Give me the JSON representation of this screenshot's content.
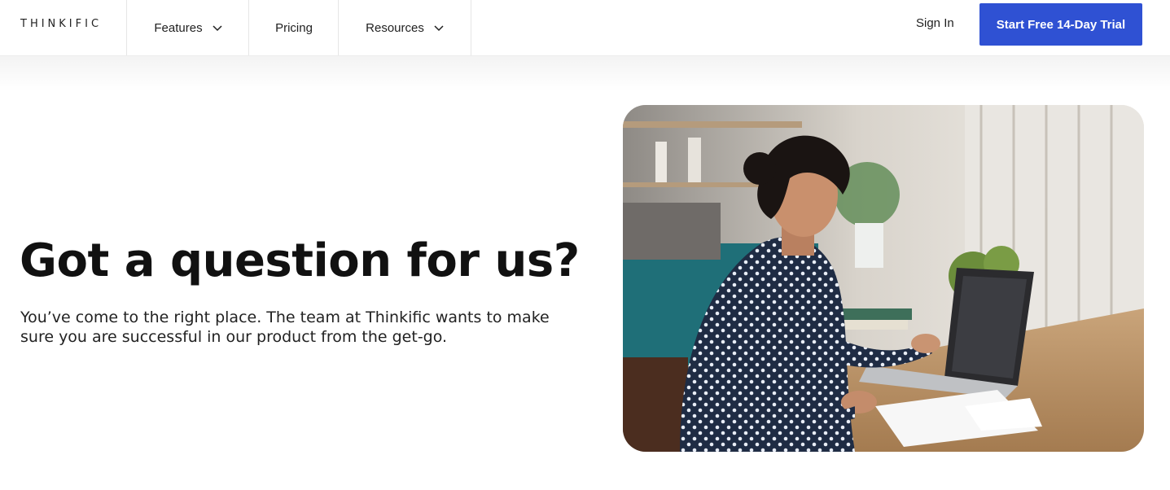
{
  "header": {
    "logo_text": "THINKIFIC",
    "nav": [
      {
        "label": "Features",
        "has_dropdown": true
      },
      {
        "label": "Pricing",
        "has_dropdown": false
      },
      {
        "label": "Resources",
        "has_dropdown": true
      }
    ],
    "sign_in_label": "Sign In",
    "cta_label": "Start Free 14-Day Trial"
  },
  "hero": {
    "title": "Got a question for us?",
    "text": "You’ve come to the right place. The team at Thinkific wants to make sure you are successful in our product from the get-go.",
    "image_icon": "woman-working-on-laptop-photo"
  },
  "colors": {
    "cta_bg": "#2f51d3",
    "cta_text": "#ffffff",
    "text": "#111111"
  }
}
